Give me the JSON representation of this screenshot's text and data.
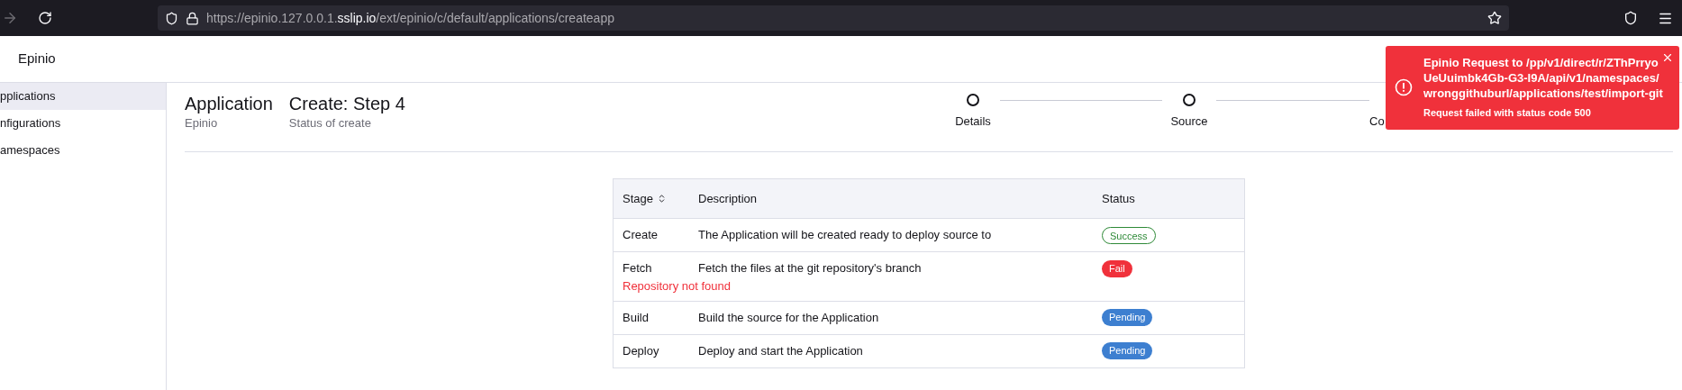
{
  "browser": {
    "url_host_prefix": "https://epinio.127.0.0.1.",
    "url_host": "sslip.io",
    "url_path": "/ext/epinio/c/default/applications/createapp"
  },
  "header": {
    "title": "Epinio"
  },
  "sidebar": {
    "items": [
      {
        "label": "pplications",
        "selected": true
      },
      {
        "label": "nfigurations",
        "selected": false
      },
      {
        "label": "amespaces",
        "selected": false
      }
    ]
  },
  "page": {
    "resource": "Application",
    "resource_sub": "Epinio",
    "title": "Create: Step 4",
    "subtitle": "Status of create"
  },
  "stepper": {
    "steps": [
      {
        "label": "Details"
      },
      {
        "label": "Source"
      },
      {
        "label": "Co"
      }
    ]
  },
  "table": {
    "columns": [
      {
        "label": "Stage",
        "sortable": true
      },
      {
        "label": "Description",
        "sortable": false
      },
      {
        "label": "Status",
        "sortable": false
      }
    ],
    "rows": [
      {
        "stage": "Create",
        "description": "The Application will be created ready to deploy source to",
        "status": "Success",
        "kind": "success"
      },
      {
        "stage": "Fetch",
        "description": "Fetch the files at the git repository's branch",
        "status": "Fail",
        "kind": "fail",
        "error": "Repository not found"
      },
      {
        "stage": "Build",
        "description": "Build the source for the Application",
        "status": "Pending",
        "kind": "pending"
      },
      {
        "stage": "Deploy",
        "description": "Deploy and start the Application",
        "status": "Pending",
        "kind": "pending"
      }
    ]
  },
  "toast": {
    "title": "Epinio Request to /pp/v1/direct/r/ZThPrryoUeUuimbk4Gb-G3-I9A/api/v1/namespaces/wronggithuburl/applications/test/import-git",
    "message": "Request failed with status code 500"
  }
}
